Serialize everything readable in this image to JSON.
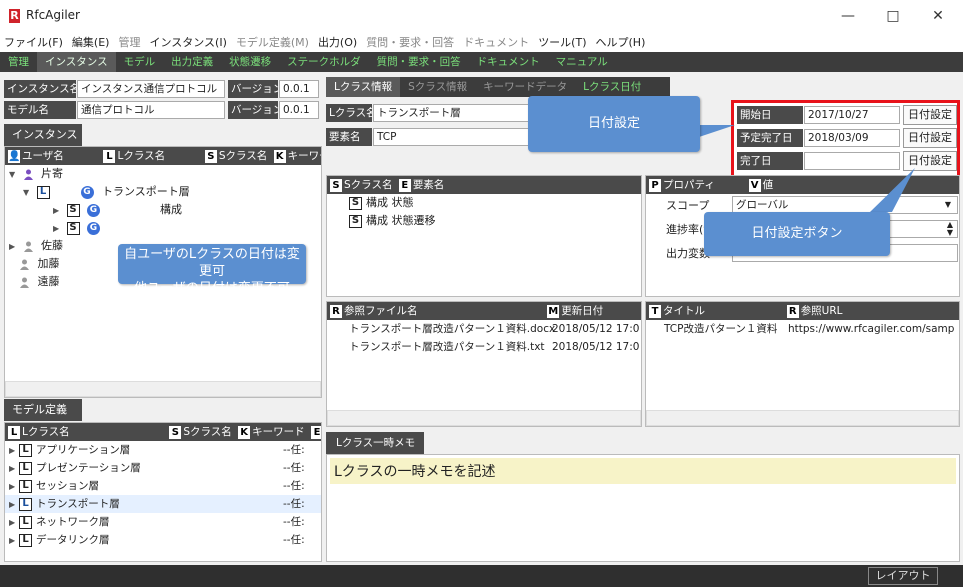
{
  "app": {
    "title": "RfcAgiler",
    "logo": "R",
    "minimize": "—",
    "maximize": "□",
    "close": "✕"
  },
  "menu": [
    "ファイル(F)",
    "編集(E)",
    "管理",
    "インスタンス(I)",
    "モデル定義(M)",
    "出力(O)",
    "質問・要求・回答",
    "ドキュメント",
    "ツール(T)",
    "ヘルプ(H)"
  ],
  "tabs": [
    "管理",
    "インスタンス",
    "モデル",
    "出力定義",
    "状態遷移",
    "ステークホルダ",
    "質問・要求・回答",
    "ドキュメント",
    "マニュアル"
  ],
  "instance": {
    "name_label": "インスタンス名",
    "name_value": "インスタンス通信プロトコル",
    "version_label": "バージョン",
    "version_value": "0.0.1"
  },
  "model": {
    "name_label": "モデル名",
    "name_value": "通信プロトコル",
    "version_label": "バージョン",
    "version_value": "0.0.1"
  },
  "instance_tab": "インスタンス",
  "tree_header": {
    "user": "ユーザ名",
    "lclass": "Lクラス名",
    "sclass": "Sクラス名",
    "keyword": "キーワード"
  },
  "tree": {
    "u1": "片寄",
    "lclass_item": "トランスポート層",
    "sub_label": "構成",
    "u2": "佐藤",
    "u3": "加藤",
    "u4": "遠藤"
  },
  "model_tab": "モデル定義",
  "model_header": {
    "lclass": "Lクラス名",
    "sclass": "Sクラス名",
    "keyword": "キーワード",
    "e": "要"
  },
  "model_list": [
    {
      "name": "アプリケーション層",
      "tail": "--任:"
    },
    {
      "name": "プレゼンテーション層",
      "tail": "--任:"
    },
    {
      "name": "セッション層",
      "tail": "--任:"
    },
    {
      "name": "トランスポート層",
      "tail": "--任:"
    },
    {
      "name": "ネットワーク層",
      "tail": "--任:"
    },
    {
      "name": "データリンク層",
      "tail": "--任:"
    }
  ],
  "detail_tabs": [
    "Lクラス情報",
    "Sクラス情報",
    "キーワードデータ",
    "Lクラス日付"
  ],
  "lclass": {
    "name_label": "Lクラス名",
    "name_value": "トランスポート層",
    "elem_label": "要素名",
    "elem_value": "TCP"
  },
  "dates": {
    "start_label": "開始日",
    "start_value": "2017/10/27",
    "plan_label": "予定完了日",
    "plan_value": "2018/03/09",
    "done_label": "完了日",
    "done_value": "",
    "button": "日付設定"
  },
  "sclass_header": {
    "s": "Sクラス名",
    "e": "要素名"
  },
  "sclass_rows": [
    {
      "s": "構成",
      "e": "状態"
    },
    {
      "s": "構成",
      "e": "状態遷移"
    }
  ],
  "prop_header": {
    "p": "プロパティ",
    "v": "値"
  },
  "props": [
    {
      "k": "スコープ",
      "v": "グローバル"
    },
    {
      "k": "進捗率(%)",
      "v": ""
    },
    {
      "k": "出力変数",
      "v": ""
    }
  ],
  "ref_header": {
    "file": "参照ファイル名",
    "date": "更新日付",
    "title": "タイトル",
    "url": "参照URL"
  },
  "refs": [
    {
      "file": "トランスポート層改造パターン１資料.docx",
      "date": "2018/05/12 17:0",
      "title": "TCP改造パターン１資料",
      "url": "https://www.rfcagiler.com/samp"
    },
    {
      "file": "トランスポート層改造パターン１資料.txt",
      "date": "2018/05/12 17:0",
      "title": "",
      "url": ""
    }
  ],
  "memo_tab": "Lクラス一時メモ",
  "memo_text": "Lクラスの一時メモを記述",
  "callouts": {
    "c1": "日付設定",
    "c2a": "自ユーザのLクラスの日付は変更可",
    "c2b": "他ユーザの日付は変更不可",
    "c3": "日付設定ボタン"
  },
  "status": {
    "layout": "レイアウト"
  },
  "colors": {
    "accent": "#e8121a",
    "callout": "#5b8fd0",
    "tab_text": "#7be07b"
  }
}
